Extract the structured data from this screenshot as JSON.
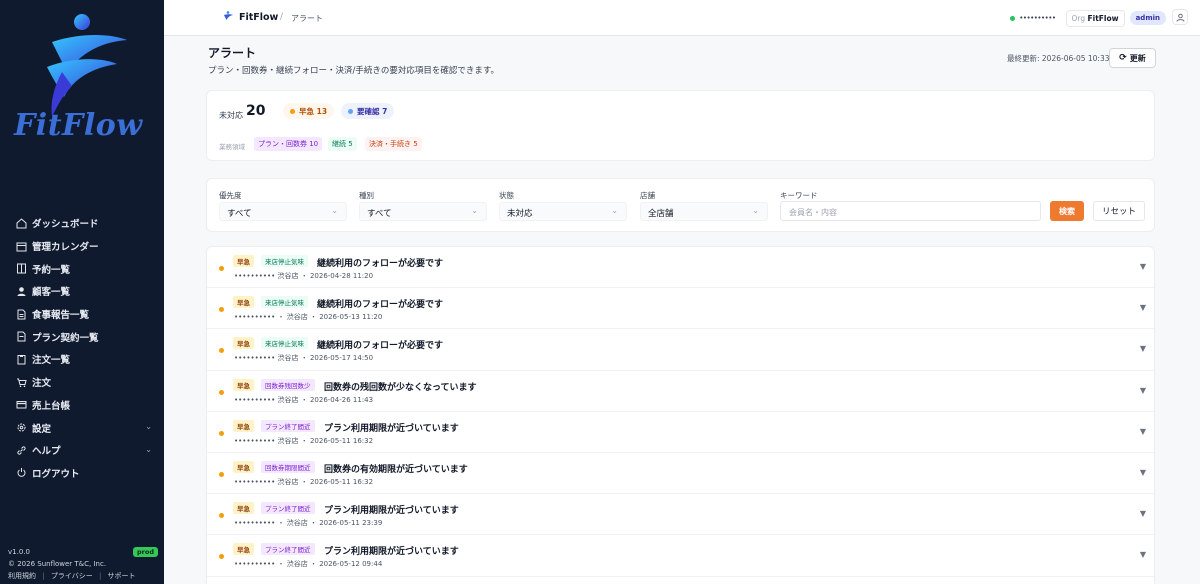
{
  "app": {
    "brand": "FitFlow",
    "header_brand": "FitFlow",
    "breadcrumb_sep": "/",
    "breadcrumb": "アラート",
    "status_text": "••••••••••",
    "org_prefix": "Org",
    "org_name": "FitFlow",
    "role": "admin",
    "colors": {
      "sidebar_bg": "#0f1a2e",
      "accent": "#ee7a2f",
      "brand_blue": "#3b6fd8",
      "urgent": "#f59e0b"
    }
  },
  "sidebar": {
    "items": [
      {
        "label": "ダッシュボード",
        "icon": "home-icon"
      },
      {
        "label": "管理カレンダー",
        "icon": "calendar-icon"
      },
      {
        "label": "予約一覧",
        "icon": "book-icon"
      },
      {
        "label": "顧客一覧",
        "icon": "person-icon"
      },
      {
        "label": "食事報告一覧",
        "icon": "document-icon"
      },
      {
        "label": "プラン契約一覧",
        "icon": "document-icon"
      },
      {
        "label": "注文一覧",
        "icon": "clipboard-icon"
      },
      {
        "label": "注文",
        "icon": "cart-icon"
      },
      {
        "label": "売上台帳",
        "icon": "card-icon"
      },
      {
        "label": "設定",
        "icon": "gear-icon",
        "expandable": true
      },
      {
        "label": "ヘルプ",
        "icon": "link-icon",
        "expandable": true
      },
      {
        "label": "ログアウト",
        "icon": "power-icon"
      }
    ],
    "footer": {
      "version": "v1.0.0",
      "env": "prod",
      "copyright": "© 2026 Sunflower T&C, Inc.",
      "links": [
        "利用規約",
        "プライバシー",
        "サポート"
      ],
      "link_sep": "|"
    }
  },
  "page": {
    "title": "アラート",
    "subtitle": "プラン・回数券・継続フォロー・決済/手続きの要対応項目を確認できます。",
    "last_updated": "最終更新: 2026-06-05 10:33",
    "refresh_label": "更新"
  },
  "summary": {
    "open_label": "未対応",
    "open_count": "20",
    "urgent": "早急 13",
    "needs_check": "要確認 7",
    "area_label": "業務領域",
    "tags": [
      "プラン・回数券 10",
      "継続 5",
      "決済・手続き 5"
    ]
  },
  "filters": {
    "priority": {
      "label": "優先度",
      "value": "すべて"
    },
    "type": {
      "label": "種別",
      "value": "すべて"
    },
    "status": {
      "label": "状態",
      "value": "未対応"
    },
    "store": {
      "label": "店舗",
      "value": "全店舗"
    },
    "keyword": {
      "label": "キーワード",
      "placeholder": "会員名・内容"
    },
    "search_label": "検索",
    "reset_label": "リセット"
  },
  "alerts": [
    {
      "priority": "早急",
      "category": "来店停止気味",
      "cat_color": "green",
      "title": "継続利用のフォローが必要です",
      "meta": "••••••••••  渋谷店 ・ 2026-04-28 11:20"
    },
    {
      "priority": "早急",
      "category": "来店停止気味",
      "cat_color": "green",
      "title": "継続利用のフォローが必要です",
      "meta": "••••••••••  ・ 渋谷店 ・ 2026-05-13 11:20"
    },
    {
      "priority": "早急",
      "category": "来店停止気味",
      "cat_color": "green",
      "title": "継続利用のフォローが必要です",
      "meta": "••••••••••  渋谷店 ・ 2026-05-17 14:50"
    },
    {
      "priority": "早急",
      "category": "回数券残回数少",
      "cat_color": "purple",
      "title": "回数券の残回数が少なくなっています",
      "meta": "••••••••••  渋谷店 ・ 2026-04-26 11:43"
    },
    {
      "priority": "早急",
      "category": "プラン終了間近",
      "cat_color": "purple",
      "title": "プラン利用期限が近づいています",
      "meta": "••••••••••  渋谷店 ・ 2026-05-11 16:32"
    },
    {
      "priority": "早急",
      "category": "回数券期限間近",
      "cat_color": "purple",
      "title": "回数券の有効期限が近づいています",
      "meta": "••••••••••  渋谷店 ・ 2026-05-11 16:32"
    },
    {
      "priority": "早急",
      "category": "プラン終了間近",
      "cat_color": "purple",
      "title": "プラン利用期限が近づいています",
      "meta": "••••••••••  ・ 渋谷店 ・ 2026-05-11 23:39"
    },
    {
      "priority": "早急",
      "category": "プラン終了間近",
      "cat_color": "purple",
      "title": "プラン利用期限が近づいています",
      "meta": "••••••••••  ・ 渋谷店 ・ 2026-05-12 09:44"
    }
  ]
}
